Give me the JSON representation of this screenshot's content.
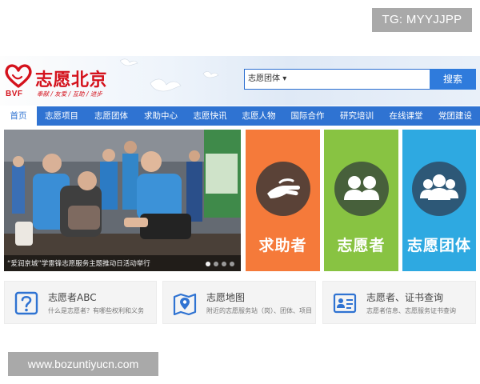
{
  "overlay": {
    "top_badge": "TG: MYYJJPP",
    "bottom_badge": "www.bozuntiyucn.com"
  },
  "header": {
    "logo_title": "志愿北京",
    "logo_abbr": "BVF",
    "logo_tagline": "奉献 / 友爱 / 互助 / 进步",
    "search": {
      "select_value": "志愿团体",
      "select_arrow": "▾",
      "button_label": "搜索"
    }
  },
  "nav": {
    "items": [
      {
        "label": "首页",
        "active": true
      },
      {
        "label": "志愿项目"
      },
      {
        "label": "志愿团体"
      },
      {
        "label": "求助中心"
      },
      {
        "label": "志愿快讯"
      },
      {
        "label": "志愿人物"
      },
      {
        "label": "国际合作"
      },
      {
        "label": "研究培训"
      },
      {
        "label": "在线课堂"
      },
      {
        "label": "党团建设"
      }
    ]
  },
  "banner": {
    "caption": "“爱润京城”学雷锋志愿服务主题推动日活动举行",
    "slide_count": 4,
    "active_slide": 1
  },
  "tiles": [
    {
      "label": "求助者",
      "icon": "helping-hand-icon",
      "color": "#f57a3a"
    },
    {
      "label": "志愿者",
      "icon": "volunteer-pair-icon",
      "color": "#88c342"
    },
    {
      "label": "志愿团体",
      "icon": "group-icon",
      "color": "#2ea9e1"
    }
  ],
  "cards": [
    {
      "title": "志愿者ABC",
      "subtitle": "什么是志愿者？有哪些权利和义务",
      "icon": "question-icon"
    },
    {
      "title": "志愿地图",
      "subtitle": "附近的志愿服务站（岗）、团体、项目",
      "icon": "map-pin-icon"
    },
    {
      "title": "志愿者、证书查询",
      "subtitle": "志愿者信息、志愿服务证书查询",
      "icon": "id-card-icon"
    }
  ],
  "colors": {
    "brand_red": "#d4121c",
    "nav_blue": "#2f73d2",
    "search_blue": "#2f7bdc"
  }
}
